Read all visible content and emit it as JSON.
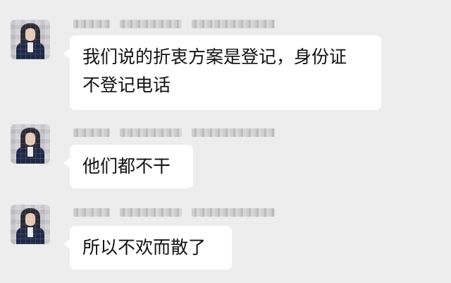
{
  "messages": [
    {
      "avatar_icon": "user-avatar-icon",
      "lines": [
        "我们说的折衷方案是登记，身份证",
        "不登记电话"
      ]
    },
    {
      "avatar_icon": "user-avatar-icon",
      "lines": [
        "他们都不干"
      ]
    },
    {
      "avatar_icon": "user-avatar-icon",
      "lines": [
        "所以不欢而散了"
      ]
    }
  ],
  "colors": {
    "background": "#ededed",
    "bubble": "#ffffff",
    "text": "#111111"
  }
}
